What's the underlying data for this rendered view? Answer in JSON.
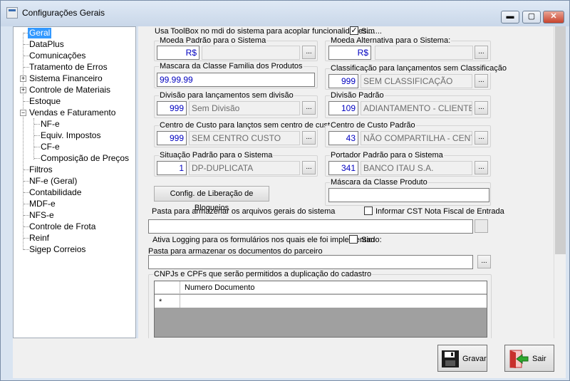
{
  "window": {
    "title": "Configurações Gerais",
    "min_label": "▬",
    "max_label": "▢",
    "close_label": "✕"
  },
  "tree": {
    "items": [
      {
        "label": "Geral",
        "selected": true
      },
      {
        "label": "DataPlus"
      },
      {
        "label": "Comunicações"
      },
      {
        "label": "Tratamento de Erros"
      },
      {
        "label": "Sistema Financeiro",
        "expander": "+"
      },
      {
        "label": "Controle de Materiais",
        "expander": "+"
      },
      {
        "label": "Estoque"
      },
      {
        "label": "Vendas e Faturamento",
        "expander": "−"
      },
      {
        "label": "NF-e"
      },
      {
        "label": "Equiv. Impostos"
      },
      {
        "label": "CF-e"
      },
      {
        "label": "Composição de Preços"
      },
      {
        "label": "Filtros"
      },
      {
        "label": "NF-e (Geral)"
      },
      {
        "label": "Contabilidade"
      },
      {
        "label": "MDF-e"
      },
      {
        "label": "NFS-e"
      },
      {
        "label": "Controle de Frota"
      },
      {
        "label": "Reinf"
      },
      {
        "label": "Sigep Correios"
      }
    ]
  },
  "form": {
    "toolbox_label": "Usa ToolBox no mdi do sistema para acoplar funcionalidades.......",
    "toolbox_checked": "✓",
    "toolbox_sim": "Sim",
    "moeda_padrao": {
      "label": "Moeda Padrão para o Sistema",
      "code": "R$",
      "desc": ""
    },
    "moeda_alt": {
      "label": "Moeda Alternativa para o Sistema:",
      "code": "R$",
      "desc": ""
    },
    "mascara_familia": {
      "label": "Mascara da Classe Familia dos Produtos",
      "value": "99.99.99"
    },
    "classificacao": {
      "label": "Classificação para lançamentos sem Classificação",
      "code": "999",
      "desc": "SEM CLASSIFICAÇÃO"
    },
    "divisao_sem": {
      "label": "Divisão para lançamentos sem divisão",
      "code": "999",
      "desc": "Sem Divisão"
    },
    "divisao_padrao": {
      "label": "Divisão Padrão",
      "code": "109",
      "desc": "ADIANTAMENTO  - CLIENTE"
    },
    "centro_sem": {
      "label": "Centro de Custo para lançtos sem centro de custo",
      "code": "999",
      "desc": "SEM CENTRO CUSTO"
    },
    "centro_padrao": {
      "label": "Centro de Custo Padrão",
      "code": "43",
      "desc": "NÃO COMPARTILHA - CENT"
    },
    "situacao": {
      "label": "Situação Padrão para o Sistema",
      "code": "1",
      "desc": "DP-DUPLICATA"
    },
    "portador": {
      "label": "Portador Padrão para o Sistema",
      "code": "341",
      "desc": "BANCO ITAU S.A."
    },
    "config_bloqueios_btn": "Config. de Liberação de Bloqueios",
    "mascara_produto": {
      "label": "Máscara da Classe Produto",
      "value": ""
    },
    "pasta_gerais_label": "Pasta para armazenar os arquivos gerais do sistema",
    "informar_cst_label": "Informar CST Nota Fiscal de Entrada",
    "pasta_gerais_value": "",
    "logging_label": "Ativa Logging para os formulários nos quais ele foi implementado:",
    "logging_sim": "Sim",
    "pasta_parceiro_label": "Pasta para armazenar os documentos do parceiro",
    "pasta_parceiro_value": "",
    "cnpj_group_label": "CNPJs e CPFs que serão permitidos a duplicação do cadastro",
    "grid_header": "Numero Documento",
    "grid_newrow_marker": "*",
    "dots": "..."
  },
  "buttons": {
    "gravar": "Gravar",
    "sair": "Sair"
  }
}
